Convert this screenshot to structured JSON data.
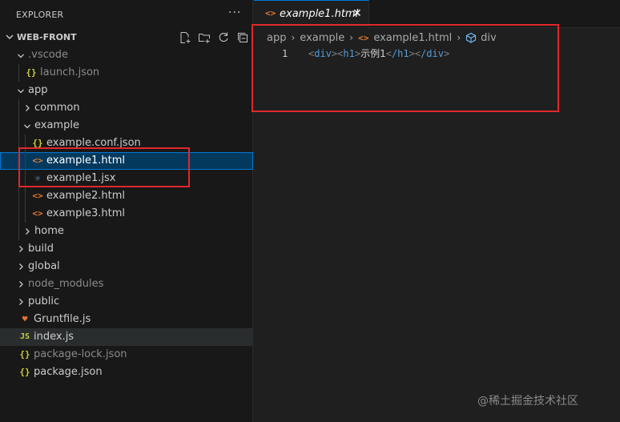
{
  "explorer": {
    "title": "EXPLORER",
    "more": "···",
    "project": "WEB-FRONT",
    "actions": [
      "new-file-icon",
      "new-folder-icon",
      "refresh-icon",
      "collapse-all-icon"
    ]
  },
  "tree": [
    {
      "label": ".vscode",
      "kind": "folder",
      "state": "open",
      "dim": true
    },
    {
      "label": "launch.json",
      "kind": "json",
      "dim": true
    },
    {
      "label": "app",
      "kind": "folder",
      "state": "open"
    },
    {
      "label": "common",
      "kind": "folder",
      "state": "closed"
    },
    {
      "label": "example",
      "kind": "folder",
      "state": "open"
    },
    {
      "label": "example.conf.json",
      "kind": "json"
    },
    {
      "label": "example1.html",
      "kind": "html",
      "selected": true
    },
    {
      "label": "example1.jsx",
      "kind": "react"
    },
    {
      "label": "example2.html",
      "kind": "html"
    },
    {
      "label": "example3.html",
      "kind": "html"
    },
    {
      "label": "home",
      "kind": "folder",
      "state": "closed"
    },
    {
      "label": "build",
      "kind": "folder",
      "state": "closed"
    },
    {
      "label": "global",
      "kind": "folder",
      "state": "closed"
    },
    {
      "label": "node_modules",
      "kind": "folder",
      "state": "closed",
      "dim": true
    },
    {
      "label": "public",
      "kind": "folder",
      "state": "closed"
    },
    {
      "label": "Gruntfile.js",
      "kind": "grunt"
    },
    {
      "label": "index.js",
      "kind": "js",
      "hovered": true
    },
    {
      "label": "package-lock.json",
      "kind": "json",
      "dim": true
    },
    {
      "label": "package.json",
      "kind": "json"
    }
  ],
  "tab": {
    "label": "example1.html",
    "close": "✕"
  },
  "breadcrumb": {
    "items": [
      "app",
      "example",
      "example1.html",
      "div"
    ]
  },
  "editor": {
    "line_number": "1",
    "code": {
      "open_div": "div",
      "open_h1": "h1",
      "text": "示例1",
      "close_h1": "/h1",
      "close_div": "/div"
    }
  },
  "watermark": "@稀土掘金技术社区",
  "colors": {
    "accent": "#0078d4",
    "annotation": "#e0282b",
    "html_icon": "#e37933",
    "json_icon": "#cbcb41",
    "react_icon": "#519aba"
  }
}
